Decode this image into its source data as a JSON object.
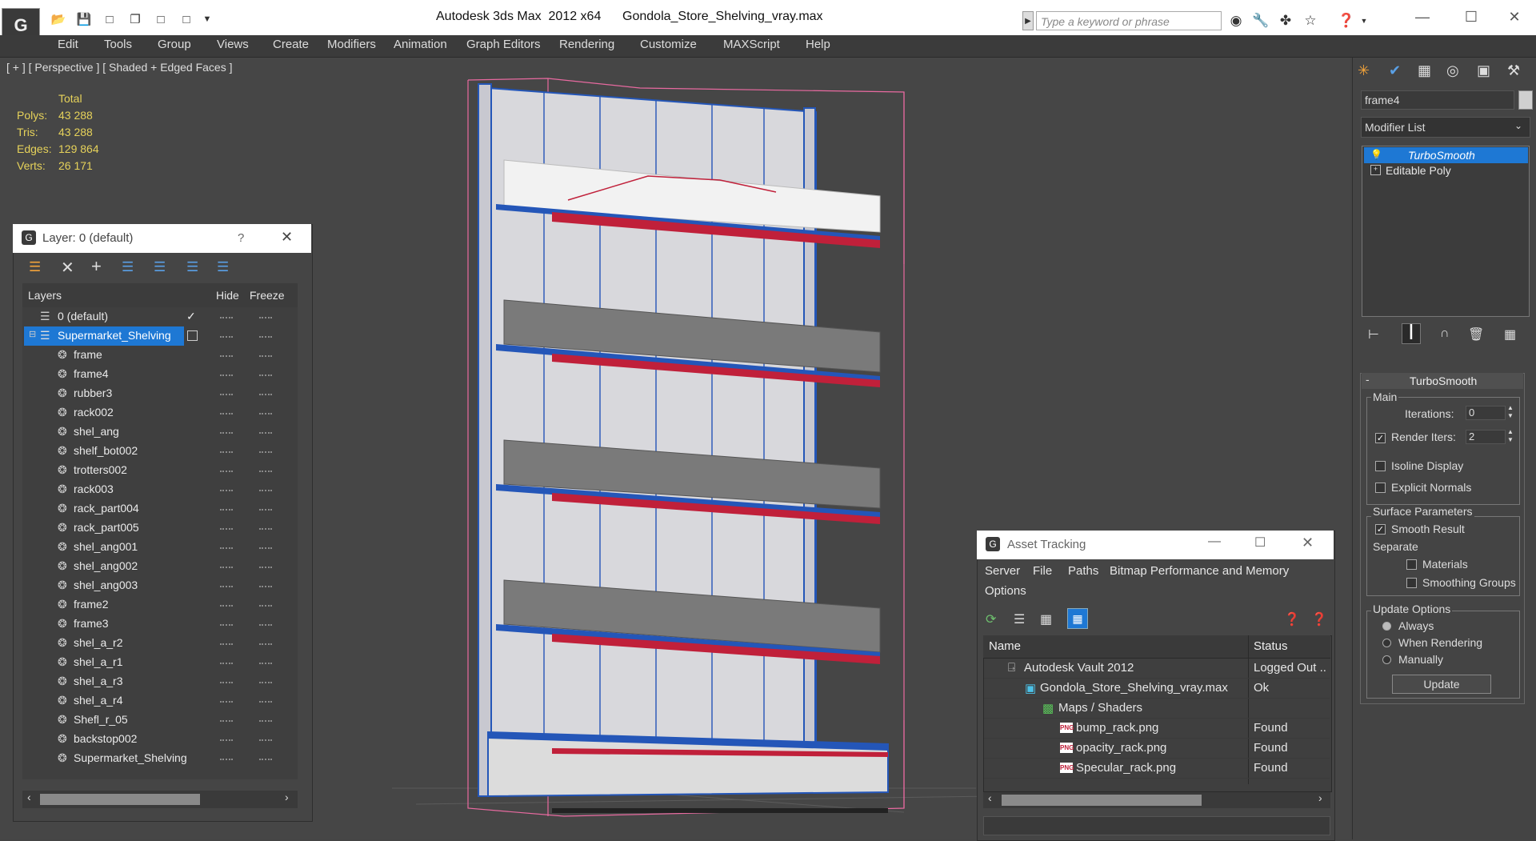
{
  "app": {
    "title": "Autodesk 3ds Max  2012 x64      Gondola_Store_Shelving_vray.max",
    "search_placeholder": "Type a keyword or phrase"
  },
  "menu": [
    "Edit",
    "Tools",
    "Group",
    "Views",
    "Create",
    "Modifiers",
    "Animation",
    "Graph Editors",
    "Rendering",
    "Customize",
    "MAXScript",
    "Help"
  ],
  "viewport": {
    "label": "[ + ] [ Perspective ] [ Shaded + Edged Faces ]",
    "stats": {
      "header": "Total",
      "rows": [
        {
          "label": "Polys:",
          "value": "43 288"
        },
        {
          "label": "Tris:",
          "value": "43 288"
        },
        {
          "label": "Edges:",
          "value": "129 864"
        },
        {
          "label": "Verts:",
          "value": "26 171"
        }
      ]
    }
  },
  "layer_dialog": {
    "title": "Layer: 0 (default)",
    "help": "?",
    "columns": [
      "Layers",
      "Hide",
      "Freeze"
    ],
    "rows": [
      {
        "name": "0 (default)"
      },
      {
        "name": "Supermarket_Shelving"
      },
      {
        "name": "frame"
      },
      {
        "name": "frame4"
      },
      {
        "name": "rubber3"
      },
      {
        "name": "rack002"
      },
      {
        "name": "shel_ang"
      },
      {
        "name": "shelf_bot002"
      },
      {
        "name": "trotters002"
      },
      {
        "name": "rack003"
      },
      {
        "name": "rack_part004"
      },
      {
        "name": "rack_part005"
      },
      {
        "name": "shel_ang001"
      },
      {
        "name": "shel_ang002"
      },
      {
        "name": "shel_ang003"
      },
      {
        "name": "frame2"
      },
      {
        "name": "frame3"
      },
      {
        "name": "shel_a_r2"
      },
      {
        "name": "shel_a_r1"
      },
      {
        "name": "shel_a_r3"
      },
      {
        "name": "shel_a_r4"
      },
      {
        "name": "Shefl_r_05"
      },
      {
        "name": "backstop002"
      },
      {
        "name": "Supermarket_Shelving"
      }
    ]
  },
  "command_panel": {
    "object_name": "frame4",
    "modifier_list": "Modifier List",
    "stack": [
      "TurboSmooth",
      "Editable Poly"
    ],
    "rollout_title": "TurboSmooth",
    "main_group": "Main",
    "iterations_label": "Iterations:",
    "iterations_value": "0",
    "render_iters_label": "Render Iters:",
    "render_iters_value": "2",
    "isoline_label": "Isoline Display",
    "explicit_normals_label": "Explicit Normals",
    "surface_group": "Surface Parameters",
    "smooth_result_label": "Smooth Result",
    "separate_label": "Separate",
    "materials_label": "Materials",
    "smoothing_groups_label": "Smoothing Groups",
    "update_group": "Update Options",
    "always_label": "Always",
    "when_rendering_label": "When Rendering",
    "manually_label": "Manually",
    "update_button": "Update"
  },
  "asset_dialog": {
    "title": "Asset Tracking",
    "menu": [
      "Server",
      "File",
      "Paths",
      "Bitmap Performance and Memory",
      "Options"
    ],
    "columns": [
      "Name",
      "Status"
    ],
    "rows": [
      {
        "name": "Autodesk Vault 2012",
        "status": "Logged Out ..",
        "icon": "vault-icon"
      },
      {
        "name": "Gondola_Store_Shelving_vray.max",
        "status": "Ok",
        "icon": "max-file-icon"
      },
      {
        "name": "Maps / Shaders",
        "status": "",
        "icon": "folder-icon"
      },
      {
        "name": "bump_rack.png",
        "status": "Found",
        "icon": "png-icon"
      },
      {
        "name": "opacity_rack.png",
        "status": "Found",
        "icon": "png-icon"
      },
      {
        "name": "Specular_rack.png",
        "status": "Found",
        "icon": "png-icon"
      }
    ]
  },
  "colors": {
    "selection": "#1e78d4",
    "stat_yellow": "#e6d25a",
    "frame_blue": "#2456b8",
    "shelf_red": "#c0203a"
  }
}
